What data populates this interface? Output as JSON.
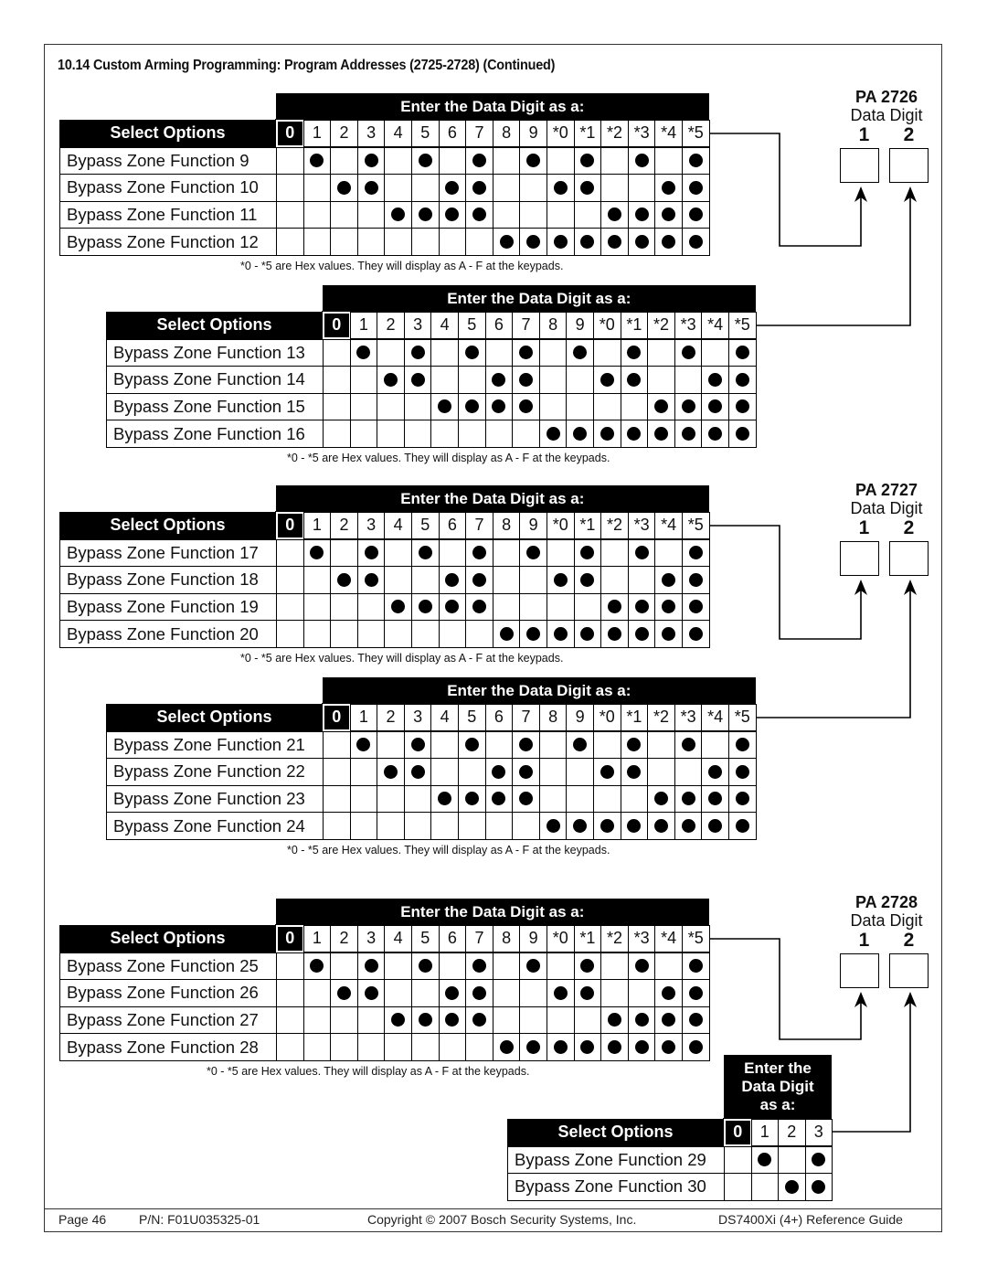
{
  "section_title": "10.14 Custom Arming Programming: Program Addresses (2725-2728) (Continued)",
  "common": {
    "band_label": "Enter the Data Digit as a:",
    "select_options_label": "Select Options",
    "columns": [
      "0",
      "1",
      "2",
      "3",
      "4",
      "5",
      "6",
      "7",
      "8",
      "9",
      "*0",
      "*1",
      "*2",
      "*3",
      "*4",
      "*5"
    ],
    "hex_note": "*0 - *5 are Hex values. They will display as A - F at the keypads."
  },
  "tables": [
    {
      "rows": [
        {
          "label": "Bypass Zone Function 9",
          "dots": [
            "1",
            "3",
            "5",
            "7",
            "9",
            "*1",
            "*3",
            "*5"
          ]
        },
        {
          "label": "Bypass Zone Function 10",
          "dots": [
            "2",
            "3",
            "6",
            "7",
            "*0",
            "*1",
            "*4",
            "*5"
          ]
        },
        {
          "label": "Bypass Zone Function 11",
          "dots": [
            "4",
            "5",
            "6",
            "7",
            "*2",
            "*3",
            "*4",
            "*5"
          ]
        },
        {
          "label": "Bypass Zone Function 12",
          "dots": [
            "8",
            "9",
            "*0",
            "*1",
            "*2",
            "*3",
            "*4",
            "*5"
          ]
        }
      ]
    },
    {
      "rows": [
        {
          "label": "Bypass Zone Function 13",
          "dots": [
            "1",
            "3",
            "5",
            "7",
            "9",
            "*1",
            "*3",
            "*5"
          ]
        },
        {
          "label": "Bypass Zone Function 14",
          "dots": [
            "2",
            "3",
            "6",
            "7",
            "*0",
            "*1",
            "*4",
            "*5"
          ]
        },
        {
          "label": "Bypass Zone Function 15",
          "dots": [
            "4",
            "5",
            "6",
            "7",
            "*2",
            "*3",
            "*4",
            "*5"
          ]
        },
        {
          "label": "Bypass Zone Function 16",
          "dots": [
            "8",
            "9",
            "*0",
            "*1",
            "*2",
            "*3",
            "*4",
            "*5"
          ]
        }
      ]
    },
    {
      "rows": [
        {
          "label": "Bypass Zone Function 17",
          "dots": [
            "1",
            "3",
            "5",
            "7",
            "9",
            "*1",
            "*3",
            "*5"
          ]
        },
        {
          "label": "Bypass Zone Function 18",
          "dots": [
            "2",
            "3",
            "6",
            "7",
            "*0",
            "*1",
            "*4",
            "*5"
          ]
        },
        {
          "label": "Bypass Zone Function 19",
          "dots": [
            "4",
            "5",
            "6",
            "7",
            "*2",
            "*3",
            "*4",
            "*5"
          ]
        },
        {
          "label": "Bypass Zone Function 20",
          "dots": [
            "8",
            "9",
            "*0",
            "*1",
            "*2",
            "*3",
            "*4",
            "*5"
          ]
        }
      ]
    },
    {
      "rows": [
        {
          "label": "Bypass Zone Function 21",
          "dots": [
            "1",
            "3",
            "5",
            "7",
            "9",
            "*1",
            "*3",
            "*5"
          ]
        },
        {
          "label": "Bypass Zone Function 22",
          "dots": [
            "2",
            "3",
            "6",
            "7",
            "*0",
            "*1",
            "*4",
            "*5"
          ]
        },
        {
          "label": "Bypass Zone Function 23",
          "dots": [
            "4",
            "5",
            "6",
            "7",
            "*2",
            "*3",
            "*4",
            "*5"
          ]
        },
        {
          "label": "Bypass Zone Function 24",
          "dots": [
            "8",
            "9",
            "*0",
            "*1",
            "*2",
            "*3",
            "*4",
            "*5"
          ]
        }
      ]
    },
    {
      "rows": [
        {
          "label": "Bypass Zone Function 25",
          "dots": [
            "1",
            "3",
            "5",
            "7",
            "9",
            "*1",
            "*3",
            "*5"
          ]
        },
        {
          "label": "Bypass Zone Function 26",
          "dots": [
            "2",
            "3",
            "6",
            "7",
            "*0",
            "*1",
            "*4",
            "*5"
          ]
        },
        {
          "label": "Bypass Zone Function 27",
          "dots": [
            "4",
            "5",
            "6",
            "7",
            "*2",
            "*3",
            "*4",
            "*5"
          ]
        },
        {
          "label": "Bypass Zone Function 28",
          "dots": [
            "8",
            "9",
            "*0",
            "*1",
            "*2",
            "*3",
            "*4",
            "*5"
          ]
        }
      ]
    },
    {
      "small": true,
      "band_label": "Enter the Data Digit as a:",
      "columns": [
        "0",
        "1",
        "2",
        "3"
      ],
      "rows": [
        {
          "label": "Bypass Zone Function 29",
          "dots": [
            "1",
            "3"
          ]
        },
        {
          "label": "Bypass Zone Function 30",
          "dots": [
            "2",
            "3"
          ]
        }
      ]
    }
  ],
  "program_addresses": [
    {
      "title": "PA 2726",
      "subtitle": "Data Digit",
      "digit1": "1",
      "digit2": "2"
    },
    {
      "title": "PA 2727",
      "subtitle": "Data Digit",
      "digit1": "1",
      "digit2": "2"
    },
    {
      "title": "PA 2728",
      "subtitle": "Data Digit",
      "digit1": "1",
      "digit2": "2"
    }
  ],
  "footer": {
    "page": "Page 46",
    "part_number": "P/N: F01U035325-01",
    "copyright": "Copyright © 2007 Bosch Security Systems, Inc.",
    "guide": "DS7400Xi (4+) Reference Guide"
  }
}
